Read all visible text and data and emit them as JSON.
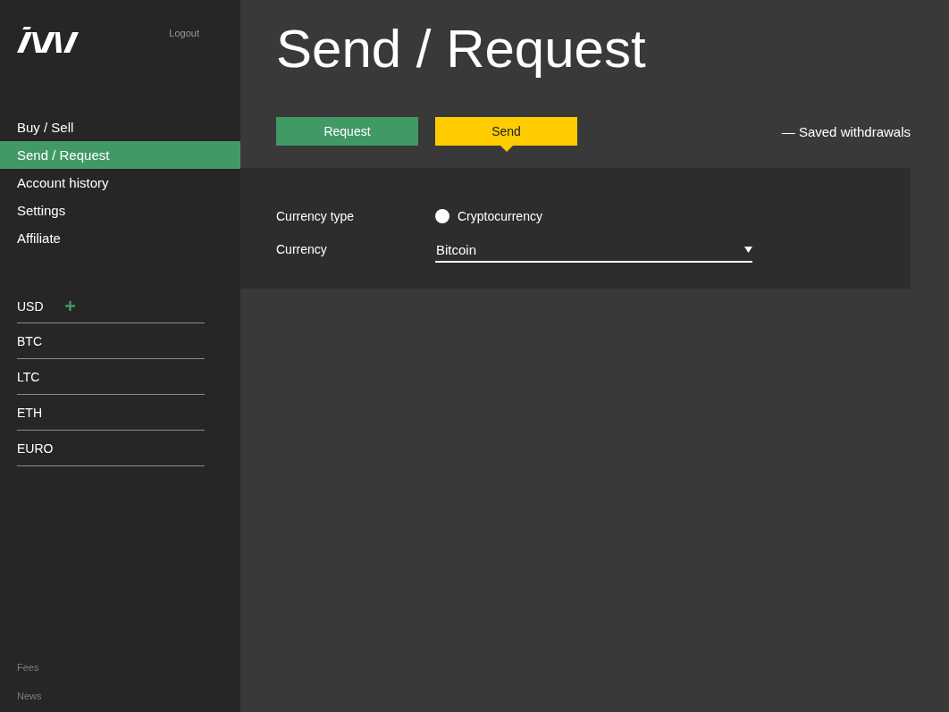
{
  "sidebar": {
    "logout": "Logout",
    "nav": [
      {
        "label": "Buy / Sell",
        "selected": false
      },
      {
        "label": "Send / Request",
        "selected": true
      },
      {
        "label": "Account history",
        "selected": false
      },
      {
        "label": "Settings",
        "selected": false
      },
      {
        "label": "Affiliate",
        "selected": false
      }
    ],
    "wallets": [
      {
        "label": "USD",
        "add_button": true
      },
      {
        "label": "BTC",
        "add_button": false
      },
      {
        "label": "LTC",
        "add_button": false
      },
      {
        "label": "ETH",
        "add_button": false
      },
      {
        "label": "EURO",
        "add_button": false
      }
    ],
    "footer_links": [
      "Fees",
      "News"
    ]
  },
  "page_title": "Send / Request",
  "tabs": [
    {
      "label": "Request",
      "selected": false,
      "color": "#419965"
    },
    {
      "label": "Send",
      "selected": true,
      "color": "#ffcc00"
    }
  ],
  "saved_link": "— Saved withdrawals",
  "form": {
    "currency_type": {
      "label": "Currency type",
      "option": "Cryptocurrency",
      "checked": false
    },
    "currency": {
      "label": "Currency",
      "value": "Bitcoin"
    }
  }
}
